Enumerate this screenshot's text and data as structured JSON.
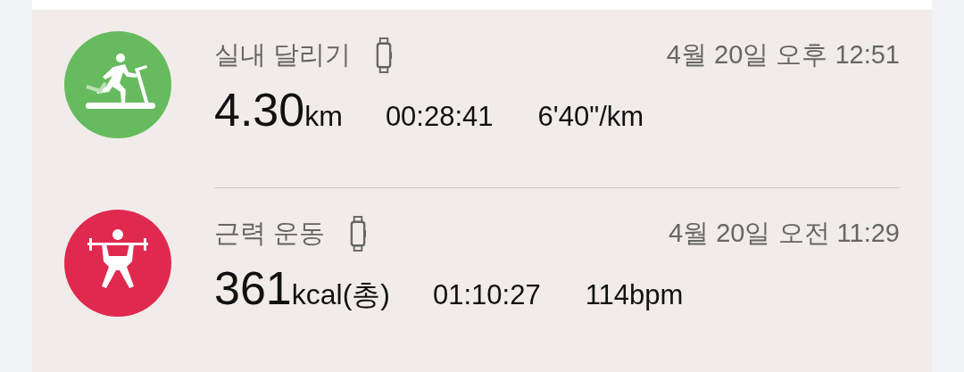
{
  "workouts": [
    {
      "kind": "treadmill",
      "color": "#66bb5e",
      "title": "실내 달리기",
      "datetime": "4월 20일 오후 12:51",
      "value": "4.30",
      "unit": "km",
      "stats": [
        "00:28:41",
        "6'40\"/km"
      ]
    },
    {
      "kind": "strength",
      "color": "#e0294f",
      "title": "근력 운동",
      "datetime": "4월 20일 오전 11:29",
      "value": "361",
      "unit": "kcal(총)",
      "stats": [
        "01:10:27",
        "114bpm"
      ]
    }
  ]
}
